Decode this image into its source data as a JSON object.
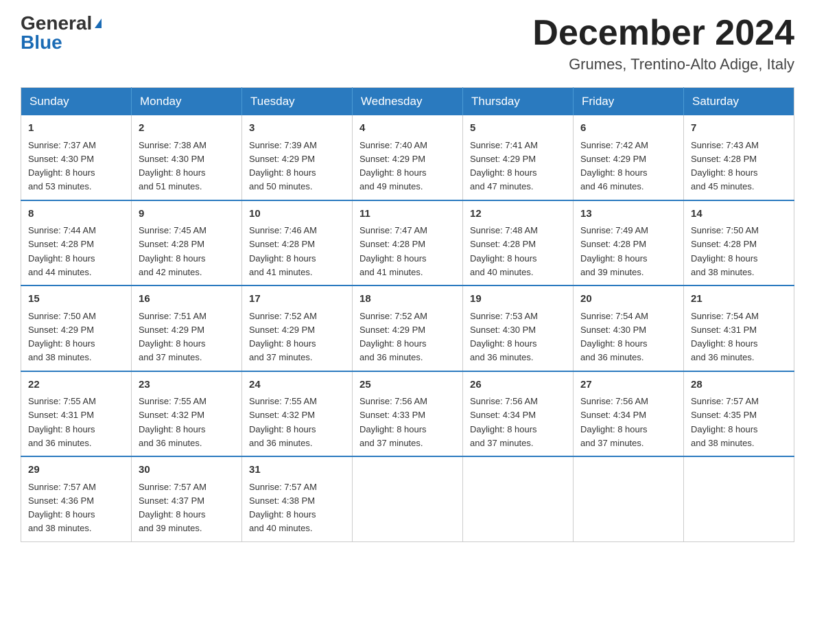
{
  "header": {
    "logo_general": "General",
    "logo_blue": "Blue",
    "month_title": "December 2024",
    "location": "Grumes, Trentino-Alto Adige, Italy"
  },
  "days_of_week": [
    "Sunday",
    "Monday",
    "Tuesday",
    "Wednesday",
    "Thursday",
    "Friday",
    "Saturday"
  ],
  "weeks": [
    [
      {
        "day": "1",
        "sunrise": "Sunrise: 7:37 AM",
        "sunset": "Sunset: 4:30 PM",
        "daylight": "Daylight: 8 hours",
        "minutes": "and 53 minutes."
      },
      {
        "day": "2",
        "sunrise": "Sunrise: 7:38 AM",
        "sunset": "Sunset: 4:30 PM",
        "daylight": "Daylight: 8 hours",
        "minutes": "and 51 minutes."
      },
      {
        "day": "3",
        "sunrise": "Sunrise: 7:39 AM",
        "sunset": "Sunset: 4:29 PM",
        "daylight": "Daylight: 8 hours",
        "minutes": "and 50 minutes."
      },
      {
        "day": "4",
        "sunrise": "Sunrise: 7:40 AM",
        "sunset": "Sunset: 4:29 PM",
        "daylight": "Daylight: 8 hours",
        "minutes": "and 49 minutes."
      },
      {
        "day": "5",
        "sunrise": "Sunrise: 7:41 AM",
        "sunset": "Sunset: 4:29 PM",
        "daylight": "Daylight: 8 hours",
        "minutes": "and 47 minutes."
      },
      {
        "day": "6",
        "sunrise": "Sunrise: 7:42 AM",
        "sunset": "Sunset: 4:29 PM",
        "daylight": "Daylight: 8 hours",
        "minutes": "and 46 minutes."
      },
      {
        "day": "7",
        "sunrise": "Sunrise: 7:43 AM",
        "sunset": "Sunset: 4:28 PM",
        "daylight": "Daylight: 8 hours",
        "minutes": "and 45 minutes."
      }
    ],
    [
      {
        "day": "8",
        "sunrise": "Sunrise: 7:44 AM",
        "sunset": "Sunset: 4:28 PM",
        "daylight": "Daylight: 8 hours",
        "minutes": "and 44 minutes."
      },
      {
        "day": "9",
        "sunrise": "Sunrise: 7:45 AM",
        "sunset": "Sunset: 4:28 PM",
        "daylight": "Daylight: 8 hours",
        "minutes": "and 42 minutes."
      },
      {
        "day": "10",
        "sunrise": "Sunrise: 7:46 AM",
        "sunset": "Sunset: 4:28 PM",
        "daylight": "Daylight: 8 hours",
        "minutes": "and 41 minutes."
      },
      {
        "day": "11",
        "sunrise": "Sunrise: 7:47 AM",
        "sunset": "Sunset: 4:28 PM",
        "daylight": "Daylight: 8 hours",
        "minutes": "and 41 minutes."
      },
      {
        "day": "12",
        "sunrise": "Sunrise: 7:48 AM",
        "sunset": "Sunset: 4:28 PM",
        "daylight": "Daylight: 8 hours",
        "minutes": "and 40 minutes."
      },
      {
        "day": "13",
        "sunrise": "Sunrise: 7:49 AM",
        "sunset": "Sunset: 4:28 PM",
        "daylight": "Daylight: 8 hours",
        "minutes": "and 39 minutes."
      },
      {
        "day": "14",
        "sunrise": "Sunrise: 7:50 AM",
        "sunset": "Sunset: 4:28 PM",
        "daylight": "Daylight: 8 hours",
        "minutes": "and 38 minutes."
      }
    ],
    [
      {
        "day": "15",
        "sunrise": "Sunrise: 7:50 AM",
        "sunset": "Sunset: 4:29 PM",
        "daylight": "Daylight: 8 hours",
        "minutes": "and 38 minutes."
      },
      {
        "day": "16",
        "sunrise": "Sunrise: 7:51 AM",
        "sunset": "Sunset: 4:29 PM",
        "daylight": "Daylight: 8 hours",
        "minutes": "and 37 minutes."
      },
      {
        "day": "17",
        "sunrise": "Sunrise: 7:52 AM",
        "sunset": "Sunset: 4:29 PM",
        "daylight": "Daylight: 8 hours",
        "minutes": "and 37 minutes."
      },
      {
        "day": "18",
        "sunrise": "Sunrise: 7:52 AM",
        "sunset": "Sunset: 4:29 PM",
        "daylight": "Daylight: 8 hours",
        "minutes": "and 36 minutes."
      },
      {
        "day": "19",
        "sunrise": "Sunrise: 7:53 AM",
        "sunset": "Sunset: 4:30 PM",
        "daylight": "Daylight: 8 hours",
        "minutes": "and 36 minutes."
      },
      {
        "day": "20",
        "sunrise": "Sunrise: 7:54 AM",
        "sunset": "Sunset: 4:30 PM",
        "daylight": "Daylight: 8 hours",
        "minutes": "and 36 minutes."
      },
      {
        "day": "21",
        "sunrise": "Sunrise: 7:54 AM",
        "sunset": "Sunset: 4:31 PM",
        "daylight": "Daylight: 8 hours",
        "minutes": "and 36 minutes."
      }
    ],
    [
      {
        "day": "22",
        "sunrise": "Sunrise: 7:55 AM",
        "sunset": "Sunset: 4:31 PM",
        "daylight": "Daylight: 8 hours",
        "minutes": "and 36 minutes."
      },
      {
        "day": "23",
        "sunrise": "Sunrise: 7:55 AM",
        "sunset": "Sunset: 4:32 PM",
        "daylight": "Daylight: 8 hours",
        "minutes": "and 36 minutes."
      },
      {
        "day": "24",
        "sunrise": "Sunrise: 7:55 AM",
        "sunset": "Sunset: 4:32 PM",
        "daylight": "Daylight: 8 hours",
        "minutes": "and 36 minutes."
      },
      {
        "day": "25",
        "sunrise": "Sunrise: 7:56 AM",
        "sunset": "Sunset: 4:33 PM",
        "daylight": "Daylight: 8 hours",
        "minutes": "and 37 minutes."
      },
      {
        "day": "26",
        "sunrise": "Sunrise: 7:56 AM",
        "sunset": "Sunset: 4:34 PM",
        "daylight": "Daylight: 8 hours",
        "minutes": "and 37 minutes."
      },
      {
        "day": "27",
        "sunrise": "Sunrise: 7:56 AM",
        "sunset": "Sunset: 4:34 PM",
        "daylight": "Daylight: 8 hours",
        "minutes": "and 37 minutes."
      },
      {
        "day": "28",
        "sunrise": "Sunrise: 7:57 AM",
        "sunset": "Sunset: 4:35 PM",
        "daylight": "Daylight: 8 hours",
        "minutes": "and 38 minutes."
      }
    ],
    [
      {
        "day": "29",
        "sunrise": "Sunrise: 7:57 AM",
        "sunset": "Sunset: 4:36 PM",
        "daylight": "Daylight: 8 hours",
        "minutes": "and 38 minutes."
      },
      {
        "day": "30",
        "sunrise": "Sunrise: 7:57 AM",
        "sunset": "Sunset: 4:37 PM",
        "daylight": "Daylight: 8 hours",
        "minutes": "and 39 minutes."
      },
      {
        "day": "31",
        "sunrise": "Sunrise: 7:57 AM",
        "sunset": "Sunset: 4:38 PM",
        "daylight": "Daylight: 8 hours",
        "minutes": "and 40 minutes."
      },
      null,
      null,
      null,
      null
    ]
  ]
}
